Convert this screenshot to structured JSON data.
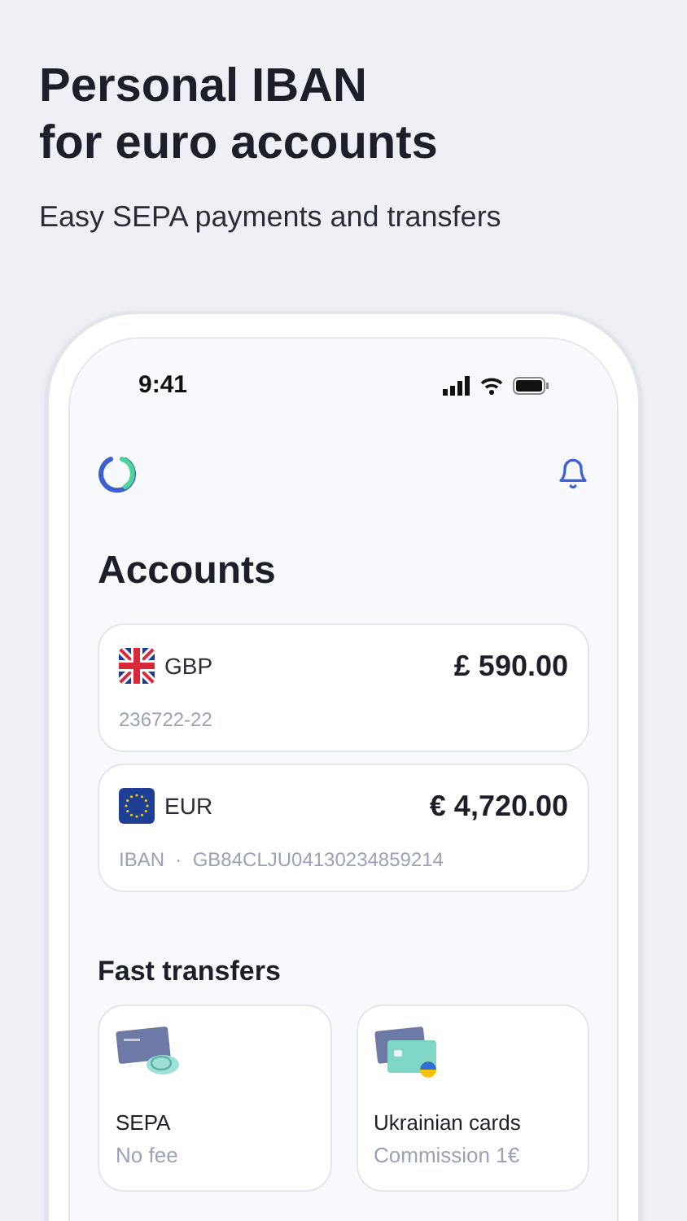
{
  "headline": {
    "title_lines": [
      "Personal IBAN",
      "for euro accounts"
    ],
    "subtitle": "Easy SEPA payments and transfers"
  },
  "status_bar": {
    "time": "9:41"
  },
  "accounts_section": {
    "title": "Accounts",
    "accounts": [
      {
        "kind": "gb",
        "currency": "GBP",
        "balance": "£ 590.00",
        "details": "236722-22"
      },
      {
        "kind": "eu",
        "currency": "EUR",
        "balance": "€ 4,720.00",
        "details": "IBAN  ·  GB84CLJU04130234859214"
      }
    ]
  },
  "fast_transfers": {
    "title": "Fast transfers",
    "items": [
      {
        "kind": "sepa",
        "title": "SEPA",
        "subtitle": "No fee"
      },
      {
        "kind": "ukraine",
        "title": "Ukrainian cards",
        "subtitle": "Commission 1€"
      }
    ]
  }
}
